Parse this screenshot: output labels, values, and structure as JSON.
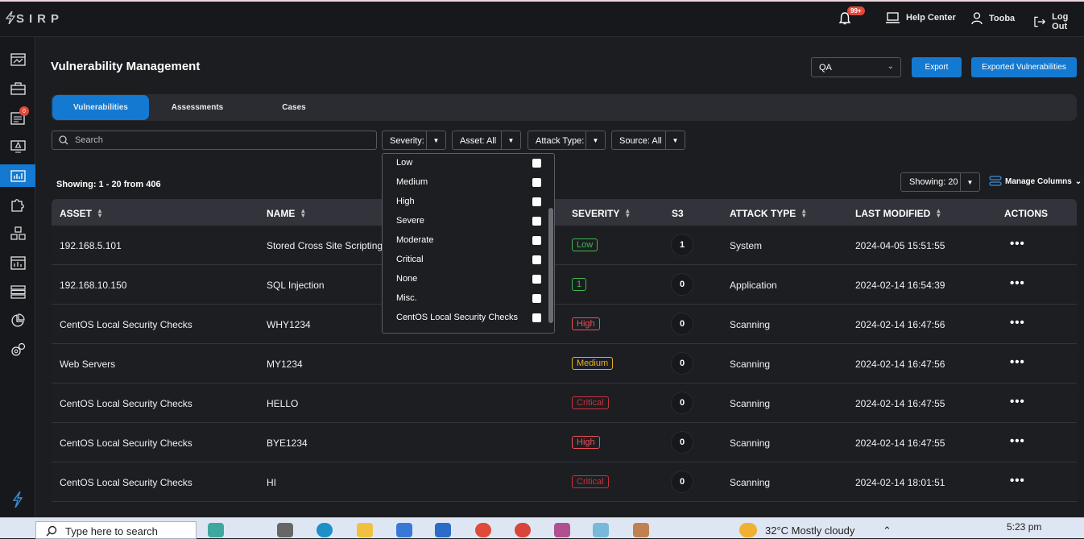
{
  "header": {
    "logo": "SIRP",
    "notifications_badge": "99+",
    "help_center": "Help Center",
    "user_name": "Tooba",
    "logout": "Log Out"
  },
  "sidebar": {
    "badge": "0"
  },
  "page": {
    "title": "Vulnerability Management",
    "env_value": "QA",
    "export_label": "Export",
    "exported_vulns_label": "Exported Vulnerabilities"
  },
  "tabs": [
    {
      "label": "Vulnerabilities"
    },
    {
      "label": "Assessments"
    },
    {
      "label": "Cases"
    }
  ],
  "filters": {
    "search_placeholder": "Search",
    "severity": "Severity:",
    "asset": "Asset: All",
    "attack_type": "Attack Type:",
    "source": "Source: All"
  },
  "listing": {
    "showing": "Showing: 1 - 20 from 406",
    "page_size": "Showing: 20",
    "manage_columns": "Manage Columns"
  },
  "table": {
    "headers": [
      "ASSET",
      "NAME",
      "SEVERITY",
      "S3",
      "ATTACK TYPE",
      "LAST MODIFIED",
      "ACTIONS"
    ],
    "rows": [
      {
        "asset": "192.168.5.101",
        "name": "Stored Cross Site Scripting",
        "severity": "Low",
        "sev_color": "#3fb950",
        "s3": "1",
        "attack": "System",
        "modified": "2024-04-05 15:51:55"
      },
      {
        "asset": "192.168.10.150",
        "name": "SQL Injection",
        "severity": "1",
        "sev_color": "#3fb950",
        "s3": "0",
        "attack": "Application",
        "modified": "2024-02-14 16:54:39"
      },
      {
        "asset": "CentOS Local Security Checks",
        "name": "WHY1234",
        "severity": "High",
        "sev_color": "#f0505a",
        "s3": "0",
        "attack": "Scanning",
        "modified": "2024-02-14 16:47:56"
      },
      {
        "asset": "Web Servers",
        "name": "MY1234",
        "severity": "Medium",
        "sev_color": "#e6b422",
        "s3": "0",
        "attack": "Scanning",
        "modified": "2024-02-14 16:47:56"
      },
      {
        "asset": "CentOS Local Security Checks",
        "name": "HELLO",
        "severity": "Critical",
        "sev_color": "#c8323c",
        "s3": "0",
        "attack": "Scanning",
        "modified": "2024-02-14 16:47:55"
      },
      {
        "asset": "CentOS Local Security Checks",
        "name": "BYE1234",
        "severity": "High",
        "sev_color": "#f0505a",
        "s3": "0",
        "attack": "Scanning",
        "modified": "2024-02-14 16:47:55"
      },
      {
        "asset": "CentOS Local Security Checks",
        "name": "HI",
        "severity": "Critical",
        "sev_color": "#c8323c",
        "s3": "0",
        "attack": "Scanning",
        "modified": "2024-02-14 18:01:51"
      }
    ],
    "actions_label": "•••"
  },
  "severity_dropdown": {
    "options": [
      "Low",
      "Medium",
      "High",
      "Severe",
      "Moderate",
      "Critical",
      "None",
      "Misc.",
      "CentOS Local Security Checks"
    ]
  },
  "taskbar": {
    "search_placeholder": "Type here to search",
    "weather": "32°C  Mostly cloudy",
    "time": "5:23 pm"
  }
}
